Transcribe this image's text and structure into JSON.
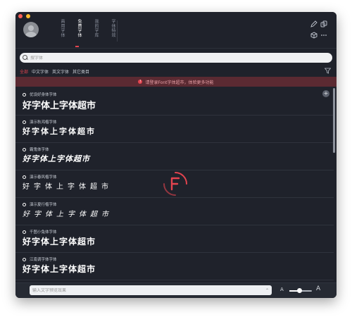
{
  "tabs": [
    {
      "label": "商用字体"
    },
    {
      "label": "免费字体"
    },
    {
      "label": "我的字库"
    },
    {
      "label": "字体特效"
    }
  ],
  "tool_icons": [
    "pen-icon",
    "copy-icon",
    "cube-icon",
    "more-icon"
  ],
  "search": {
    "placeholder": "搜字体"
  },
  "filters": [
    {
      "label": "全部"
    },
    {
      "label": "中文字体"
    },
    {
      "label": "英文字体"
    },
    {
      "label": "其它类目"
    }
  ],
  "banner": {
    "text": "请登录Font字体超市，体验更多功能"
  },
  "fonts": [
    {
      "name": "优设好身体字体",
      "sample": "好字体上字体超市"
    },
    {
      "name": "演示秋鸿楷字体",
      "sample": "好字体上字体超市"
    },
    {
      "name": "霸鬼体字体",
      "sample": "好字体上字体超市"
    },
    {
      "name": "演示春风楷字体",
      "sample": "好字体上字体超市"
    },
    {
      "name": "演示夏行楷字体",
      "sample": "好字体上字体超市"
    },
    {
      "name": "千图小兔体字体",
      "sample": "好字体上字体超市"
    },
    {
      "name": "江南调字体字体",
      "sample": "好字体上字体超市"
    }
  ],
  "bottom": {
    "preview_placeholder": "输入文字预览效果",
    "size_small": "A",
    "size_large": "A",
    "size_level": 0.45
  },
  "colors": {
    "accent": "#e3444f",
    "background": "#1f222b"
  }
}
